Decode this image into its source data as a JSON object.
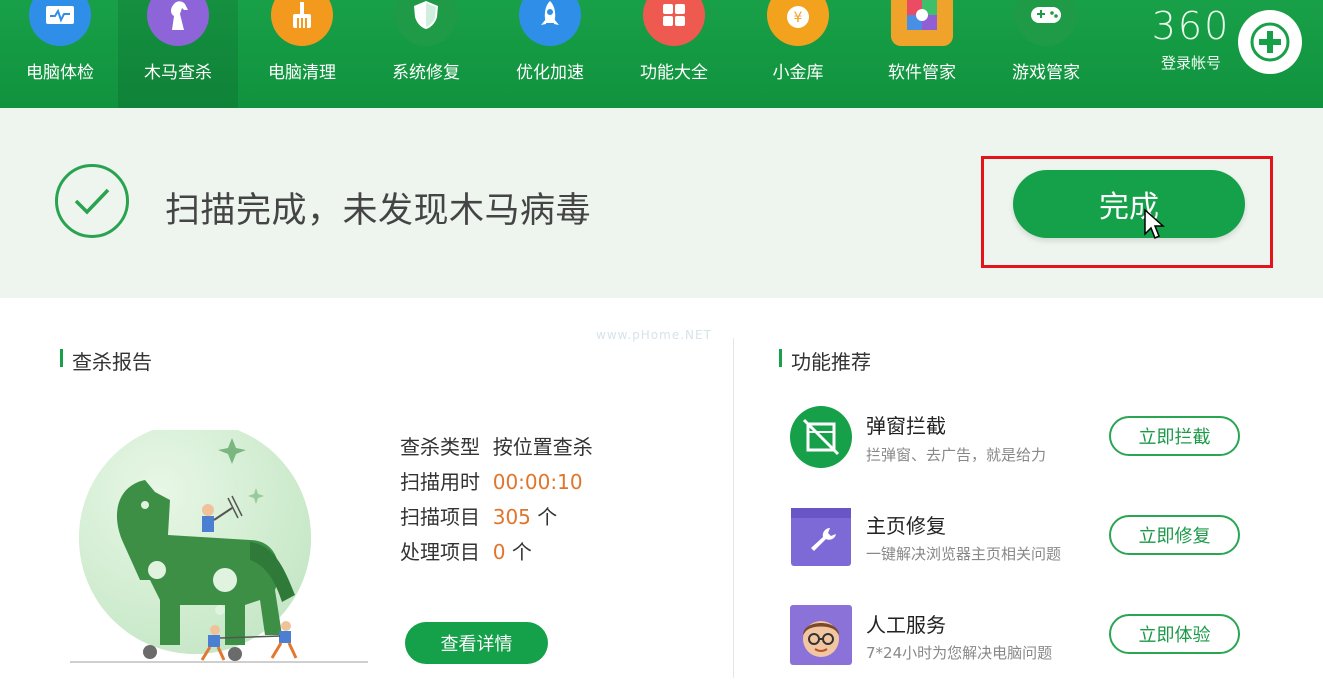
{
  "nav": {
    "items": [
      {
        "label": "电脑体检",
        "icon": "monitor-icon",
        "color": "#2f8fe8"
      },
      {
        "label": "木马查杀",
        "icon": "horse-icon",
        "color": "#8e64d9"
      },
      {
        "label": "电脑清理",
        "icon": "broom-icon",
        "color": "#f39a1e"
      },
      {
        "label": "系统修复",
        "icon": "shield-icon",
        "color": "#1f9a46"
      },
      {
        "label": "优化加速",
        "icon": "rocket-icon",
        "color": "#2f8fe8"
      },
      {
        "label": "功能大全",
        "icon": "grid-icon",
        "color": "#ee5a4f"
      },
      {
        "label": "小金库",
        "icon": "yen-coin-icon",
        "color": "#f3a21d"
      },
      {
        "label": "软件管家",
        "icon": "apps-box-icon",
        "color": "#f0a32b"
      },
      {
        "label": "游戏管家",
        "icon": "gamepad-icon",
        "color": "#1f9a46"
      }
    ],
    "active_index": 1
  },
  "brand": {
    "number": "360",
    "login": "登录帐号"
  },
  "banner": {
    "result_text": "扫描完成，未发现木马病毒",
    "done_label": "完成"
  },
  "report": {
    "title": "查杀报告",
    "stats": [
      {
        "label": "查杀类型",
        "value": "按位置查杀",
        "unit": ""
      },
      {
        "label": "扫描用时",
        "value": "00:00:10",
        "unit": ""
      },
      {
        "label": "扫描项目",
        "value": "305",
        "unit": "个"
      },
      {
        "label": "处理项目",
        "value": "0",
        "unit": "个"
      }
    ],
    "detail_button": "查看详情"
  },
  "recommend": {
    "title": "功能推荐",
    "items": [
      {
        "title": "弹窗拦截",
        "desc": "拦弹窗、去广告，就是给力",
        "button": "立即拦截",
        "icon": "popup-block-icon"
      },
      {
        "title": "主页修复",
        "desc": "一键解决浏览器主页相关问题",
        "button": "立即修复",
        "icon": "wrench-icon"
      },
      {
        "title": "人工服务",
        "desc": "7*24小时为您解决电脑问题",
        "button": "立即体验",
        "icon": "support-agent-icon"
      }
    ]
  },
  "watermark": "www.pHome.NET",
  "colors": {
    "brand_green": "#15a04a",
    "highlight_red": "#e3151a",
    "value_orange": "#e0752b"
  }
}
